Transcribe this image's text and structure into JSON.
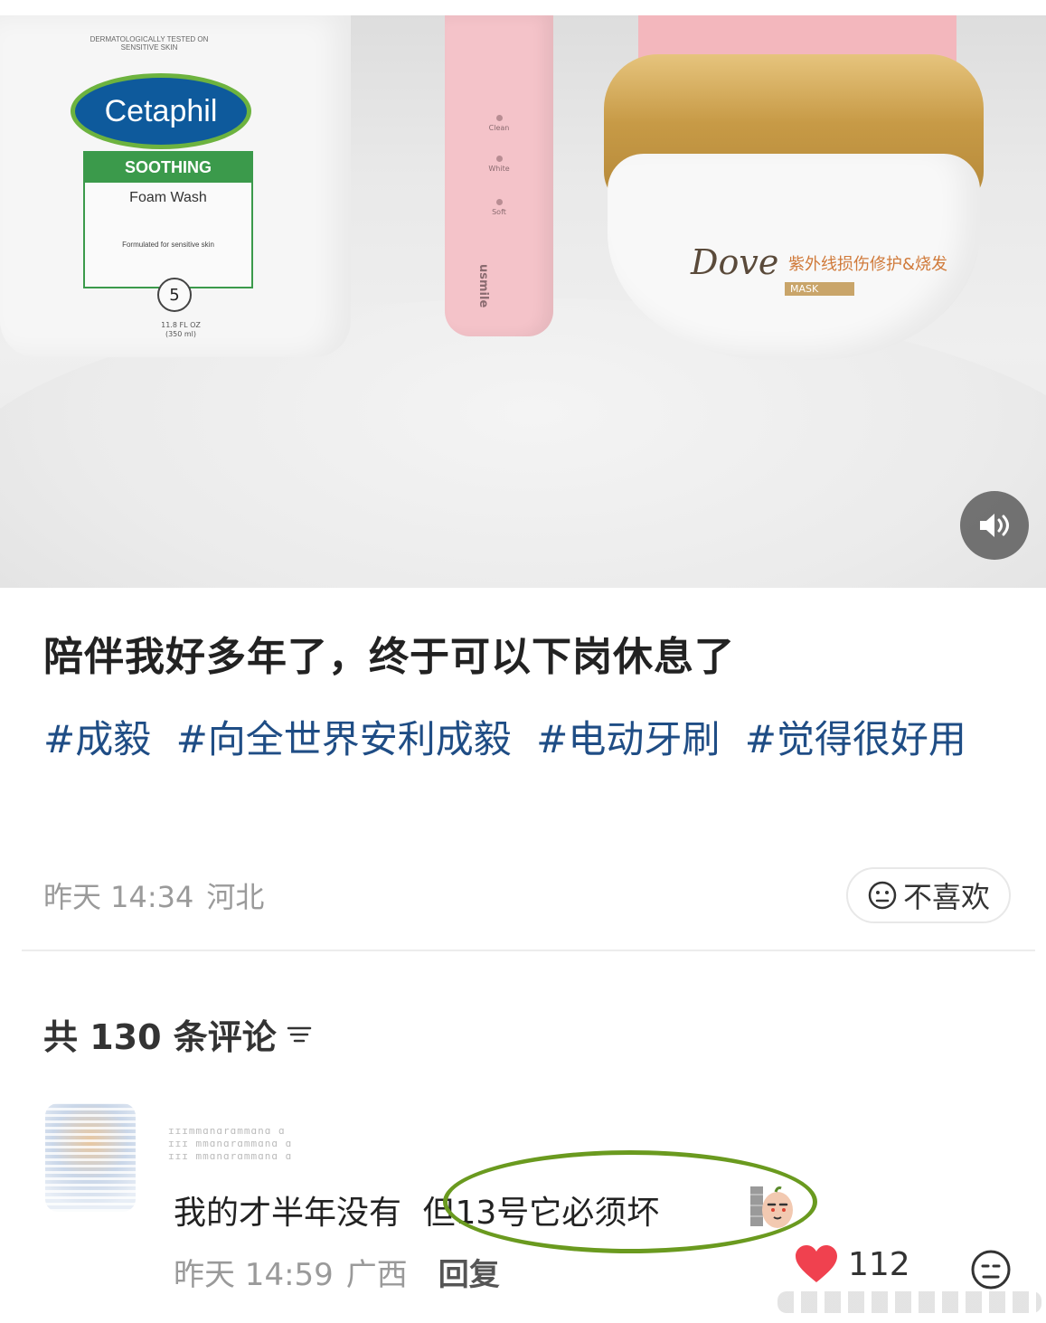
{
  "media": {
    "cetaphil_tested": "DERMATOLOGICALLY TESTED ON SENSITIVE SKIN",
    "cetaphil_brand": "Cetaphil",
    "cetaphil_soothing": "SOOTHING",
    "cetaphil_product": "Foam Wash",
    "cetaphil_formulated": "Formulated for sensitive skin",
    "cetaphil_badge": "5",
    "cetaphil_volume": "11.8 FL OZ (350 ml)",
    "brush_modes": [
      "Clean",
      "White",
      "Soft"
    ],
    "brush_brand": "usmile",
    "dove_brand": "Dove",
    "dove_cn": "紫外线损伤修护&烧发",
    "dove_mask": "MASK",
    "sound_icon": "speaker-icon"
  },
  "post": {
    "title": "陪伴我好多年了，终于可以下岗休息了",
    "tags": [
      "#成毅",
      "#向全世界安利成毅",
      "#电动牙刷",
      "#觉得很好用"
    ],
    "time": "昨天 14:34",
    "location": "河北",
    "dislike_label": "不喜欢"
  },
  "comments_header": {
    "label": "共 130 条评论"
  },
  "comment": {
    "username_lines": [
      "ɪɪɪmmɑnɑrɑmmɑnɑ  ɑ",
      "ɪɪɪ mmɑnɑrɑmmɑnɑ ɑ",
      "ɪɪɪ mmɑnɑrɑmmɑnɑ  ɑ"
    ],
    "text_before": "我的才半年没有",
    "text_highlight": "但13号它必须坏",
    "time": "昨天 14:59",
    "location": "广西",
    "reply_label": "回复",
    "likes": "112"
  },
  "colors": {
    "tag": "#1f4d85",
    "highlight_ring": "#6a9a1f",
    "like_heart": "#f0414f"
  }
}
